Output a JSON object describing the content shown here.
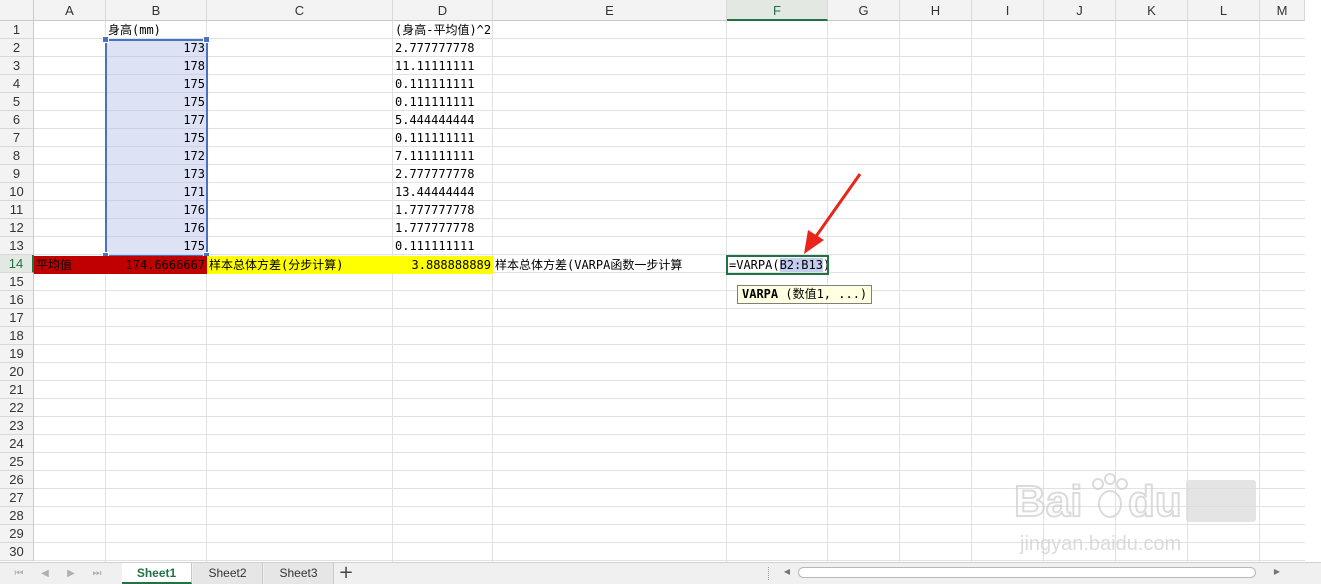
{
  "columns": [
    "A",
    "B",
    "C",
    "D",
    "E",
    "F",
    "G",
    "H",
    "I",
    "J",
    "K",
    "L",
    "M"
  ],
  "rows": [
    "1",
    "2",
    "3",
    "4",
    "5",
    "6",
    "7",
    "8",
    "9",
    "10",
    "11",
    "12",
    "13",
    "14",
    "15",
    "16",
    "17",
    "18",
    "19",
    "20",
    "21",
    "22",
    "23",
    "24",
    "25",
    "26",
    "27",
    "28",
    "29",
    "30"
  ],
  "active_column": "F",
  "active_row": "14",
  "cells": {
    "B1": "身高(mm)",
    "D1": "(身高-平均值)^2",
    "B_values": [
      "173",
      "178",
      "175",
      "175",
      "177",
      "175",
      "172",
      "173",
      "171",
      "176",
      "176",
      "175"
    ],
    "D_values": [
      "2.777777778",
      "11.11111111",
      "0.111111111",
      "0.111111111",
      "5.444444444",
      "0.111111111",
      "7.111111111",
      "2.777777778",
      "13.44444444",
      "1.777777778",
      "1.777777778",
      "0.111111111"
    ],
    "A14": "平均值",
    "B14": "174.6666667",
    "C14": "样本总体方差(分步计算)",
    "D14": "3.888888889",
    "E14": "样本总体方差(VARPA函数一步计算",
    "F14_prefix": "=VARPA(",
    "F14_ref": "B2:B13",
    "F14_suffix": ")"
  },
  "tooltip": {
    "func": "VARPA",
    "args": " (数值1, ...)"
  },
  "sheet_tabs": [
    "Sheet1",
    "Sheet2",
    "Sheet3"
  ],
  "active_tab": "Sheet1",
  "add_sheet_label": "+",
  "nav_icons": [
    "first-sheet-icon",
    "prev-sheet-icon",
    "next-sheet-icon",
    "last-sheet-icon"
  ],
  "watermark": {
    "brand": "Baidu经验",
    "url": "jingyan.baidu.com"
  },
  "colors": {
    "accent": "#217346",
    "red_fill": "#c00000",
    "yellow_fill": "#ffff00",
    "selection": "#4a72c4",
    "arrow": "#e8241b"
  }
}
